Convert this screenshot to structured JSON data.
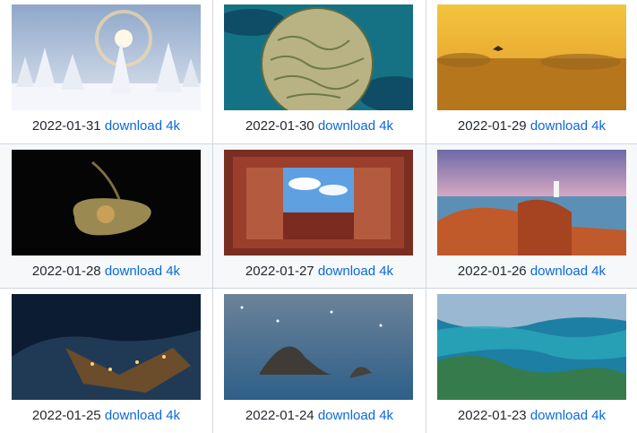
{
  "link_label": "download 4k",
  "items": [
    {
      "date": "2022-01-31",
      "link": "download 4k",
      "image": "snowy-forest-sun-halo"
    },
    {
      "date": "2022-01-30",
      "link": "download 4k",
      "image": "brain-coral"
    },
    {
      "date": "2022-01-29",
      "link": "download 4k",
      "image": "golden-meadow-bird"
    },
    {
      "date": "2022-01-28",
      "link": "download 4k",
      "image": "stingray"
    },
    {
      "date": "2022-01-27",
      "link": "download 4k",
      "image": "palace-courtyard-sky"
    },
    {
      "date": "2022-01-26",
      "link": "download 4k",
      "image": "coastal-lighthouse"
    },
    {
      "date": "2022-01-25",
      "link": "download 4k",
      "image": "city-lights-aerial"
    },
    {
      "date": "2022-01-24",
      "link": "download 4k",
      "image": "snowy-sea-rocks"
    },
    {
      "date": "2022-01-23",
      "link": "download 4k",
      "image": "tropical-bay-aerial"
    }
  ]
}
